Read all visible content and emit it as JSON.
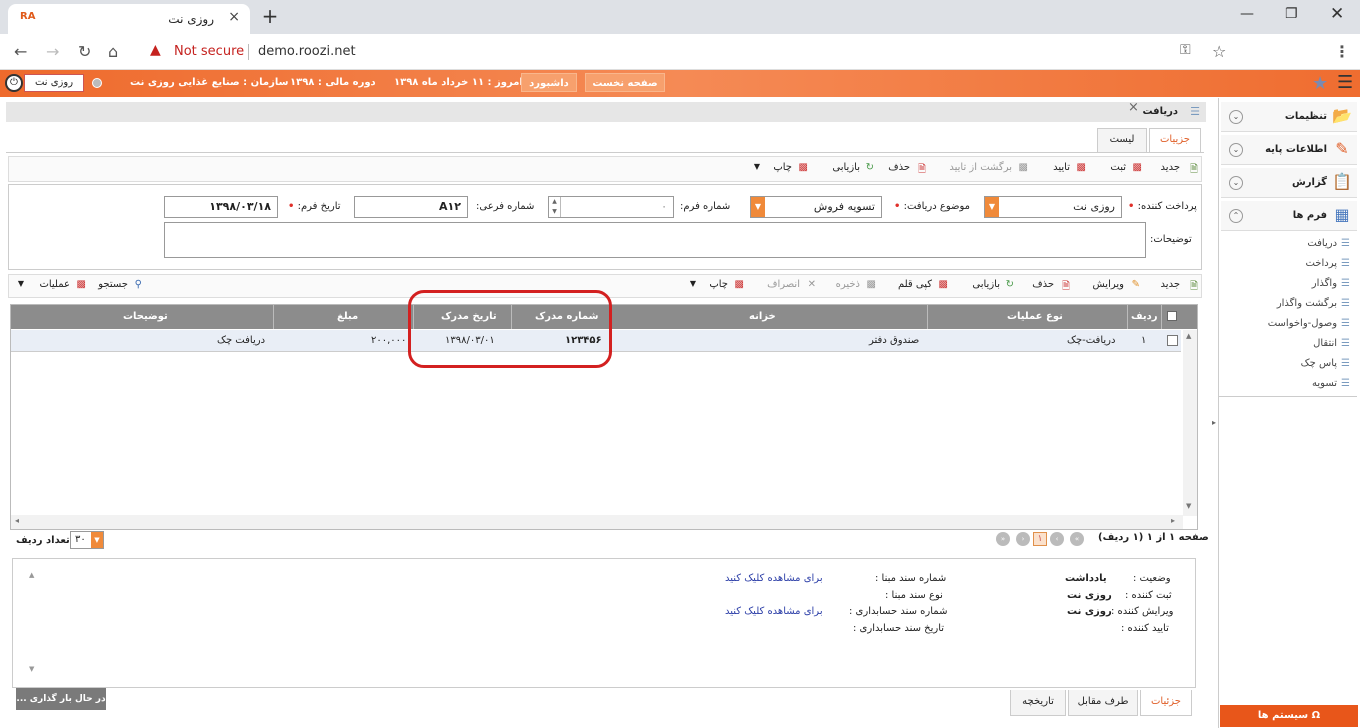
{
  "browser": {
    "tab_favicon": "RA",
    "tab_title": "روزی نت",
    "close_tab": "×",
    "new_tab": "+",
    "not_secure": "Not secure",
    "url": "demo.roozi.net"
  },
  "header": {
    "first_page": "صفحه نخست",
    "dashboard": "داشبورد",
    "today": "امروز : ۱۱ خرداد ماه ۱۳۹۸",
    "fiscal_period": "دوره مالی : ۱۳۹۸",
    "organization": "سازمان : صنایع غذایی روزی نت",
    "user": "روزی نت"
  },
  "sidebar": {
    "groups": [
      {
        "label": "تنظیمات",
        "icon": "settings-folder-icon"
      },
      {
        "label": "اطلاعات پایه",
        "icon": "pencil-icon"
      },
      {
        "label": "گزارش",
        "icon": "clipboard-icon"
      },
      {
        "label": "فرم ها",
        "icon": "grid-form-icon"
      }
    ],
    "items": [
      "دریافت",
      "پرداخت",
      "واگذار",
      "برگشت واگذار",
      "وصول-واخواست",
      "انتقال",
      "پاس چک",
      "تسویه"
    ],
    "system_button": "سیستم ها"
  },
  "form": {
    "tab_title": "دریافت",
    "view_tabs": {
      "details": "جزییات",
      "list": "لیست"
    },
    "toolbar": {
      "new": "جدید",
      "save": "ثبت",
      "approve": "تایید",
      "revert_approval": "برگشت از تایید",
      "delete": "حذف",
      "reload": "بازیابی",
      "print": "چاپ"
    },
    "fields": {
      "payer_label": "پرداخت کننده:",
      "payer_value": "روزی نت",
      "subject_label": "موضوع دریافت:",
      "subject_value": "تسویه فروش",
      "form_number_label": "شماره فرم:",
      "form_number_value": "۰",
      "sub_number_label": "شماره فرعی:",
      "sub_number_value": "A۱۲",
      "form_date_label": "تاریخ فرم:",
      "form_date_value": "۱۳۹۸/۰۳/۱۸",
      "notes_label": "توضیحات:"
    }
  },
  "grid_toolbar": {
    "new": "جدید",
    "edit": "ویرایش",
    "delete": "حذف",
    "reload": "بازیابی",
    "copy_item": "کپی قلم",
    "save": "ذخیره",
    "cancel": "انصراف",
    "print": "چاپ",
    "search": "جستجو",
    "operations": "عملیات"
  },
  "grid": {
    "columns": [
      "ردیف",
      "نوع عملیات",
      "خزانه",
      "شماره مدرک",
      "تاریخ مدرک",
      "مبلغ",
      "توضیحات"
    ],
    "rows": [
      {
        "row": "۱",
        "operation": "دریافت-چک",
        "treasury": "صندوق دفتر",
        "doc_number": "۱۲۳۴۵۶",
        "doc_date": "۱۳۹۸/۰۳/۰۱",
        "amount": "۲۰۰,۰۰۰",
        "notes": "دریافت چک"
      }
    ]
  },
  "pager": {
    "summary": "صفحه ۱ از ۱ (۱ ردیف)",
    "current_page": "۱",
    "rows_per_page_label": "تعداد ردیف",
    "rows_per_page": "۳۰"
  },
  "details": {
    "status_label": "وضعیت :",
    "status_value": "یادداشت",
    "created_by_label": "ثبت کننده :",
    "created_by_value": "روزی نت",
    "edited_by_label": "ویرایش کننده :",
    "edited_by_value": "روزی نت",
    "approved_by_label": "تایید کننده :",
    "base_doc_number_label": "شماره سند مبنا :",
    "base_doc_link": "برای مشاهده کلیک کنید",
    "base_doc_type_label": "نوع سند مبنا :",
    "acc_doc_number_label": "شماره سند حسابداری :",
    "acc_doc_link": "برای مشاهده کلیک کنید",
    "acc_doc_date_label": "تاریخ سند حسابداری :"
  },
  "bottom_tabs": {
    "details": "جزئیات",
    "counterparty": "طرف مقابل",
    "history": "تاریخچه"
  },
  "loading": "در حال بار گذاری ...",
  "colors": {
    "accent": "#ee6b2f",
    "grid_header": "#8c8c8c",
    "highlight": "#d32020"
  }
}
